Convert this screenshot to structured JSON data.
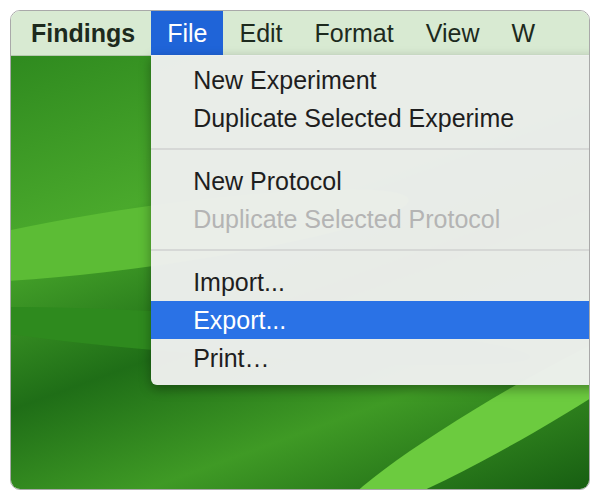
{
  "menubar": {
    "app": "Findings",
    "menus": [
      {
        "label": "File",
        "selected": true
      },
      {
        "label": "Edit",
        "selected": false
      },
      {
        "label": "Format",
        "selected": false
      },
      {
        "label": "View",
        "selected": false
      },
      {
        "label": "W",
        "selected": false
      }
    ]
  },
  "menu": {
    "sections": [
      [
        {
          "label": "New Experiment",
          "disabled": false,
          "selected": false
        },
        {
          "label": "Duplicate Selected Experime",
          "disabled": false,
          "selected": false
        }
      ],
      [
        {
          "label": "New Protocol",
          "disabled": false,
          "selected": false
        },
        {
          "label": "Duplicate Selected Protocol",
          "disabled": true,
          "selected": false
        }
      ],
      [
        {
          "label": "Import...",
          "disabled": false,
          "selected": false
        },
        {
          "label": "Export...",
          "disabled": false,
          "selected": true
        },
        {
          "label": "Print…",
          "disabled": false,
          "selected": false
        }
      ]
    ]
  }
}
